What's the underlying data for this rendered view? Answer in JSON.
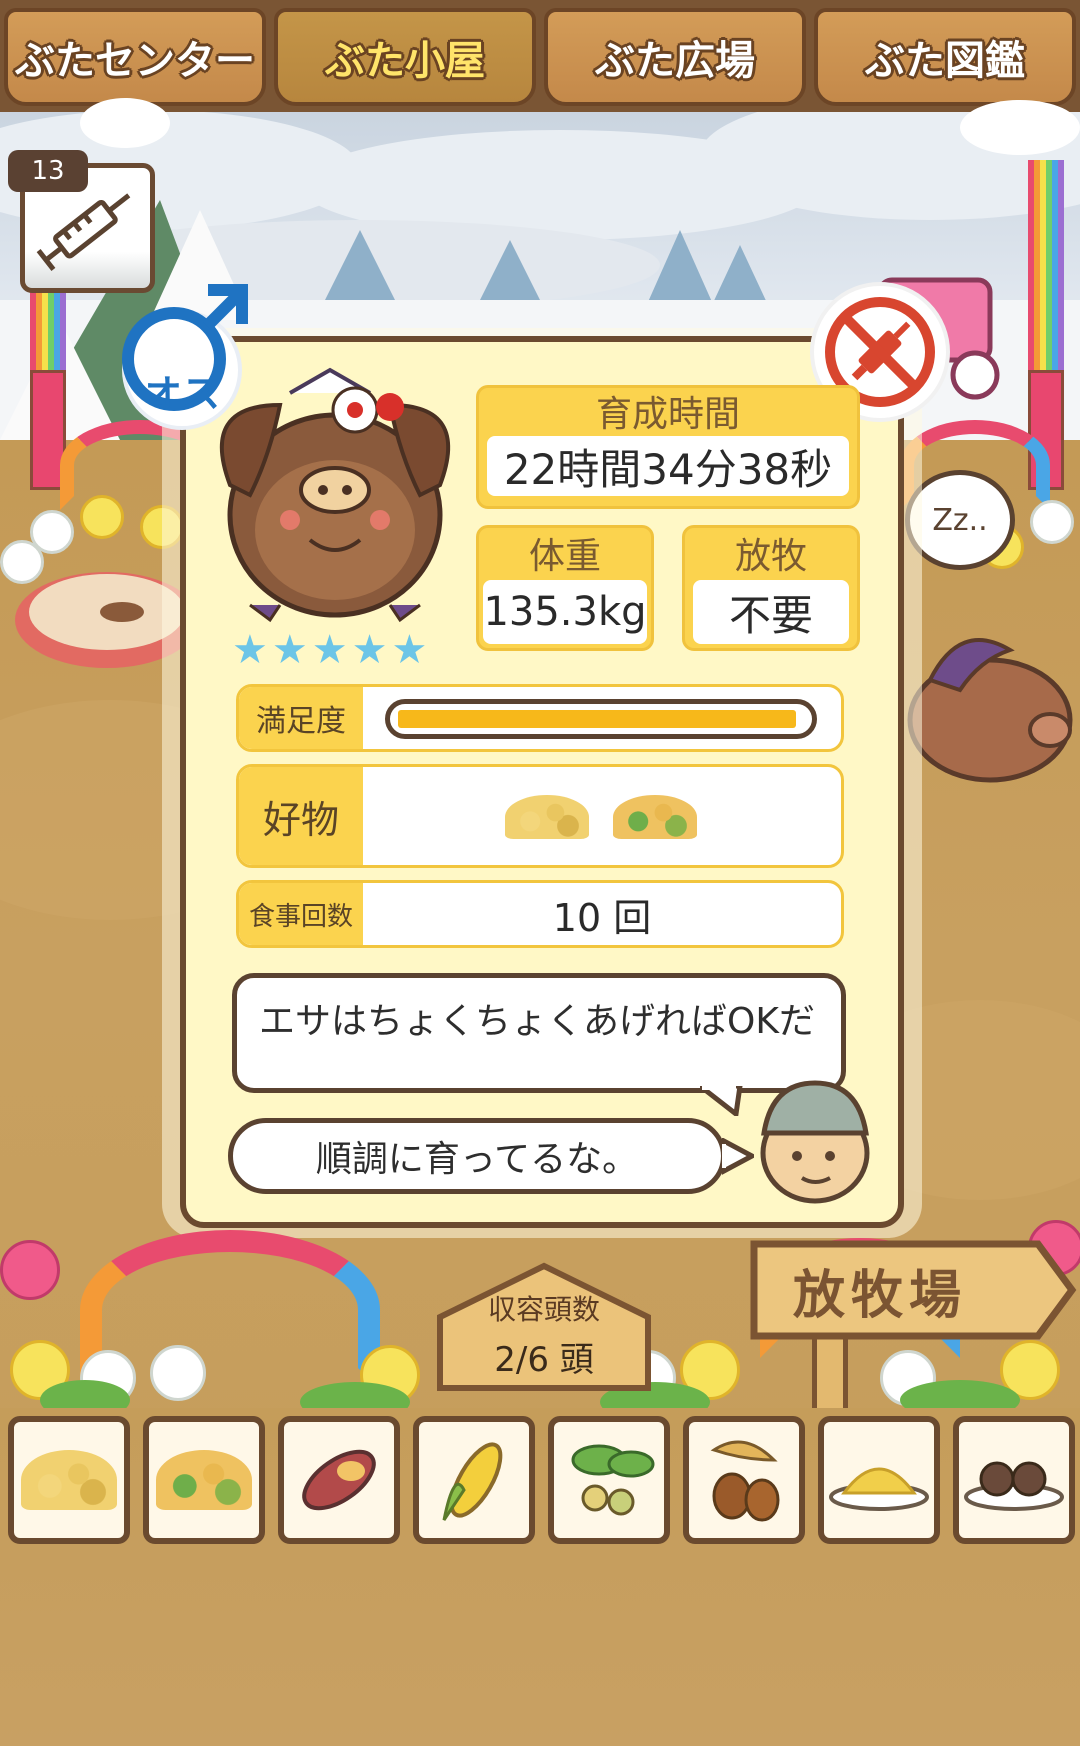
{
  "tabs": [
    {
      "label": "ぶたセンター",
      "active": false
    },
    {
      "label": "ぶた小屋",
      "active": true
    },
    {
      "label": "ぶた広場",
      "active": false
    },
    {
      "label": "ぶた図鑑",
      "active": false
    }
  ],
  "syringe": {
    "count": "13",
    "icon": "syringe-icon"
  },
  "pig": {
    "gender": "オス",
    "rating": 5,
    "stars": "★★★★★",
    "no_vaccine_icon": "no-syringe-icon"
  },
  "stats": {
    "raise_time_label": "育成時間",
    "raise_time_value": "22時間34分38秒",
    "weight_label": "体重",
    "weight_value": "135.3kg",
    "graze_label": "放牧",
    "graze_value": "不要",
    "satisfaction_label": "満足度",
    "satisfaction": 0.98,
    "favorite_label": "好物",
    "meals_label": "食事回数",
    "meals_value": "10 回"
  },
  "dialog": {
    "line1": "エサはちょくちょくあげればOKだ",
    "line2": "順調に育ってるな。"
  },
  "capacity": {
    "label": "収容頭数",
    "value": "2/6 頭"
  },
  "pasture_sign": "放牧場",
  "sleep": "Zz..",
  "foods": [
    {
      "name": "food-grain-yellow"
    },
    {
      "name": "food-grain-mixed"
    },
    {
      "name": "food-sweet-potato"
    },
    {
      "name": "food-corn"
    },
    {
      "name": "food-beans"
    },
    {
      "name": "food-acorn"
    },
    {
      "name": "food-grain-plate"
    },
    {
      "name": "food-meatballs"
    }
  ],
  "colors": {
    "accent": "#fbd34e",
    "frame": "#6b4a2f",
    "panel": "#fff8c6",
    "male": "#1f73c2",
    "ban": "#d8462f"
  }
}
